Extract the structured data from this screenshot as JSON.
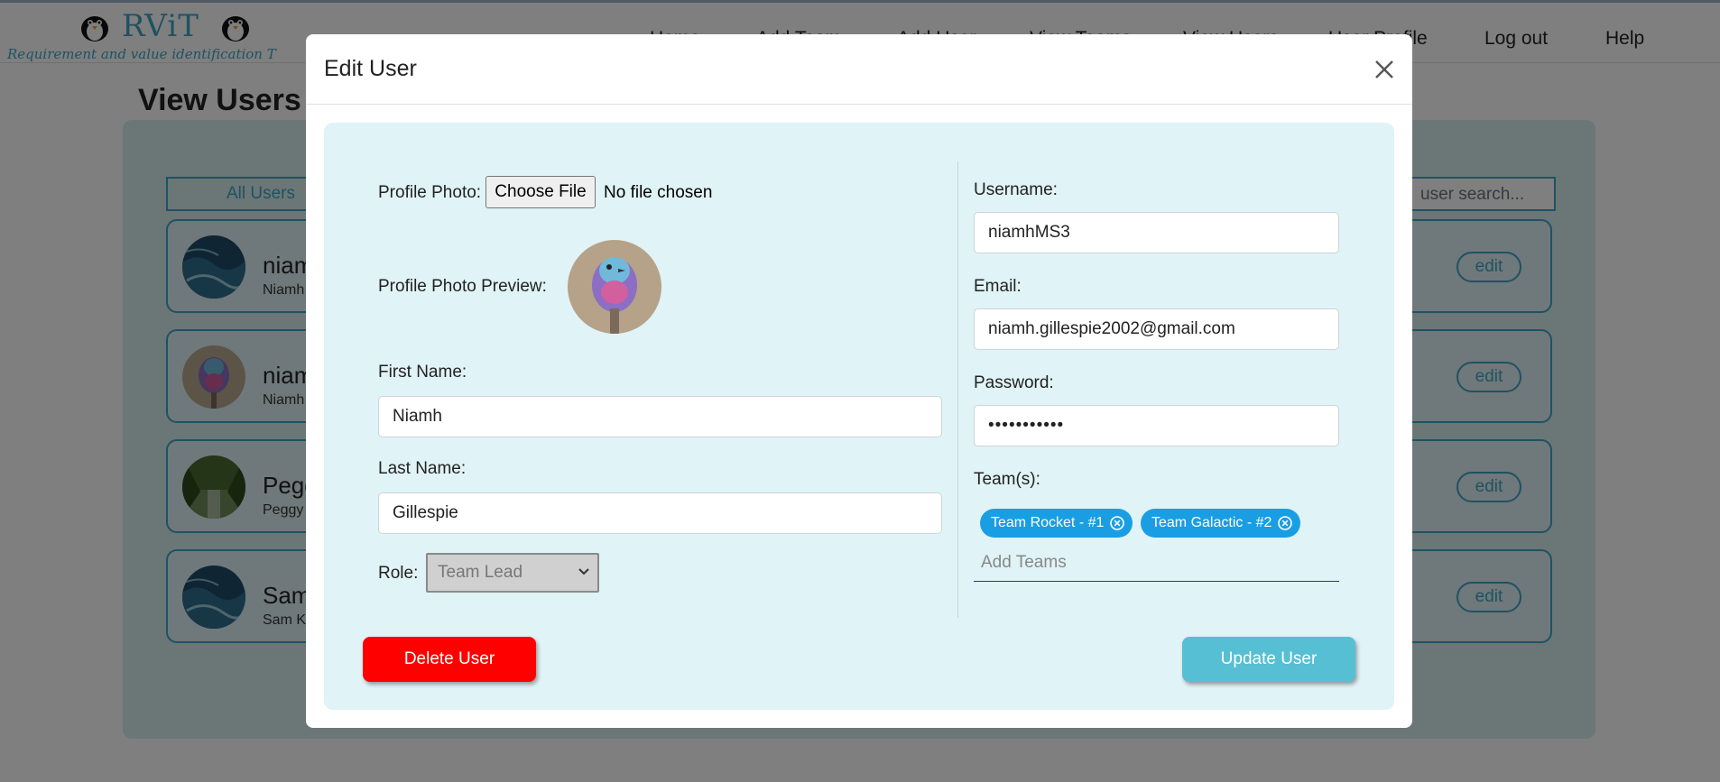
{
  "header": {
    "logo_title": "RViT",
    "logo_subtitle": "Requirement and value identification T",
    "nav_items": [
      {
        "label": "Home"
      },
      {
        "label": "Add Team"
      },
      {
        "label": "Add User"
      },
      {
        "label": "View Teams"
      },
      {
        "label": "View Users"
      },
      {
        "label": "User Profile"
      },
      {
        "label": "Log out"
      },
      {
        "label": "Help"
      }
    ]
  },
  "page": {
    "title": "View Users",
    "filter_label": "All Users",
    "search_placeholder": "user search...",
    "users": [
      {
        "name": "niamh",
        "sub": "Niamh",
        "edit_label": "edit",
        "avatar": "water"
      },
      {
        "name": "niamh",
        "sub": "Niamh",
        "edit_label": "edit",
        "avatar": "bird"
      },
      {
        "name": "Peggy",
        "sub": "Peggy",
        "edit_label": "edit",
        "avatar": "forest"
      },
      {
        "name": "Sam",
        "sub": "Sam K",
        "edit_label": "edit",
        "avatar": "water"
      }
    ]
  },
  "modal": {
    "title": "Edit User",
    "profile_photo_label": "Profile Photo:",
    "choose_file_label": "Choose File",
    "no_file_text": "No file chosen",
    "preview_label": "Profile Photo Preview:",
    "first_name_label": "First Name:",
    "first_name_value": "Niamh",
    "last_name_label": "Last Name:",
    "last_name_value": "Gillespie",
    "role_label": "Role:",
    "role_value": "Team Lead",
    "username_label": "Username:",
    "username_value": "niamhMS3",
    "email_label": "Email:",
    "email_value": "niamh.gillespie2002@gmail.com",
    "password_label": "Password:",
    "password_value": "•••••••••••",
    "teams_label": "Team(s):",
    "teams": [
      {
        "label": "Team Rocket - #1"
      },
      {
        "label": "Team Galactic - #2"
      }
    ],
    "add_teams_placeholder": "Add Teams",
    "delete_label": "Delete User",
    "update_label": "Update User"
  },
  "colors": {
    "accent": "#3fa4c4",
    "chip": "#1a9ee3",
    "delete": "#ff0000",
    "update": "#57bfd3"
  },
  "icons": [
    "penguin-icon",
    "close-icon",
    "chevron-down-icon",
    "remove-chip-icon"
  ]
}
